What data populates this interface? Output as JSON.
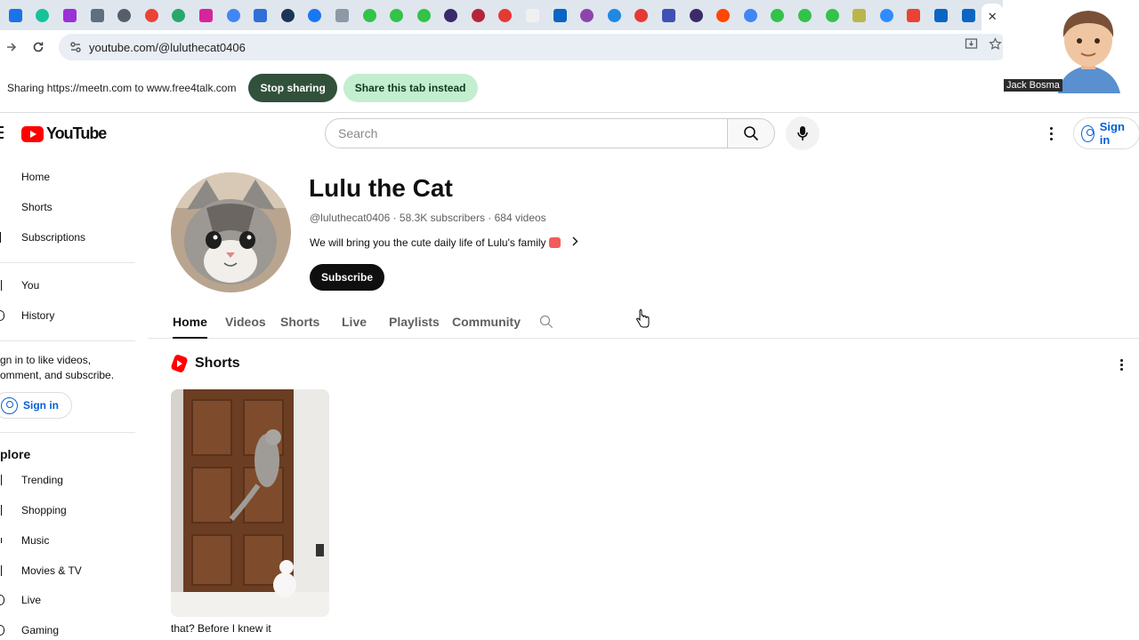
{
  "browser": {
    "tab_favicons": [
      {
        "icon": "mail-icon",
        "color": "#1a73e8",
        "square": true
      },
      {
        "icon": "grammarly-icon",
        "color": "#15c39a",
        "square": false
      },
      {
        "icon": "mail-badge-icon",
        "color": "#9b30d9",
        "square": true
      },
      {
        "icon": "chart-icon",
        "color": "#5f6f7f",
        "square": true
      },
      {
        "icon": "globe-icon",
        "color": "#555f6b",
        "square": false
      },
      {
        "icon": "google-icon",
        "color": "#ea4335",
        "square": false
      },
      {
        "icon": "tool-icon",
        "color": "#27a86b",
        "square": false
      },
      {
        "icon": "instagram-icon",
        "color": "#d6249f",
        "square": true
      },
      {
        "icon": "google-icon",
        "color": "#4285f4",
        "square": false
      },
      {
        "icon": "tab-icon",
        "color": "#2f6fd8",
        "square": true
      },
      {
        "icon": "tab-icon",
        "color": "#1c3556",
        "square": false
      },
      {
        "icon": "facebook-icon",
        "color": "#1877f2",
        "square": false
      },
      {
        "icon": "tab-icon",
        "color": "#8d99a6",
        "square": true
      },
      {
        "icon": "play-icon",
        "color": "#33c24a",
        "square": false
      },
      {
        "icon": "play-icon",
        "color": "#33c24a",
        "square": false
      },
      {
        "icon": "play-icon",
        "color": "#33c24a",
        "square": false
      },
      {
        "icon": "peace-icon",
        "color": "#3a2a6a",
        "square": false
      },
      {
        "icon": "tab-icon",
        "color": "#b3263a",
        "square": false
      },
      {
        "icon": "record-icon",
        "color": "#e53935",
        "square": false
      },
      {
        "icon": "blank-icon",
        "color": "#f0f0f0",
        "square": true
      },
      {
        "icon": "linkedin-icon",
        "color": "#0a66c2",
        "square": true
      },
      {
        "icon": "tab-icon",
        "color": "#8e44ad",
        "square": false
      },
      {
        "icon": "tab-icon",
        "color": "#1e88e5",
        "square": false
      },
      {
        "icon": "record-icon",
        "color": "#e53935",
        "square": false
      },
      {
        "icon": "tab-icon",
        "color": "#3f51b5",
        "square": true
      },
      {
        "icon": "peace-icon",
        "color": "#3a2a6a",
        "square": false
      },
      {
        "icon": "reddit-icon",
        "color": "#ff4500",
        "square": false
      },
      {
        "icon": "google-icon",
        "color": "#4285f4",
        "square": false
      },
      {
        "icon": "play-icon",
        "color": "#33c24a",
        "square": false
      },
      {
        "icon": "play-icon",
        "color": "#33c24a",
        "square": false
      },
      {
        "icon": "play-icon",
        "color": "#33c24a",
        "square": false
      },
      {
        "icon": "tab-icon",
        "color": "#b9b74a",
        "square": true
      },
      {
        "icon": "zoom-icon",
        "color": "#2d8cff",
        "square": false
      },
      {
        "icon": "gmail-icon",
        "color": "#ea4335",
        "square": true
      },
      {
        "icon": "linkedin-icon",
        "color": "#0a66c2",
        "square": true
      },
      {
        "icon": "linkedin-icon",
        "color": "#0a66c2",
        "square": true
      }
    ],
    "active_tab_close": "✕",
    "url": "youtube.com/@luluthecat0406"
  },
  "sharing": {
    "text": "Sharing https://meetn.com to www.free4talk.com",
    "stop_label": "Stop sharing",
    "share_tab_label": "Share this tab instead"
  },
  "overlay": {
    "name": "Jack Bosma"
  },
  "header": {
    "logo_text": "YouTube",
    "search_placeholder": "Search",
    "sign_in": "Sign in"
  },
  "sidebar": {
    "items_top": [
      "Home",
      "Shorts",
      "Subscriptions"
    ],
    "items_you": [
      "You",
      "History"
    ],
    "signin_prompt_line1": "gn in to like videos,",
    "signin_prompt_line2": "omment, and subscribe.",
    "signin_button": "Sign in",
    "explore_heading": "plore",
    "explore_items": [
      "Trending",
      "Shopping",
      "Music",
      "Movies & TV",
      "Live",
      "Gaming"
    ]
  },
  "channel": {
    "name": "Lulu the Cat",
    "meta": "@luluthecat0406 · 58.3K subscribers · 684 videos",
    "description": "We will bring you the cute daily life of Lulu's family",
    "subscribe_label": "Subscribe",
    "tabs": [
      "Home",
      "Videos",
      "Shorts",
      "Live",
      "Playlists",
      "Community"
    ],
    "active_tab": "Home"
  },
  "shorts": {
    "heading": "Shorts",
    "items": [
      {
        "title": "that? Before I knew it"
      }
    ]
  }
}
